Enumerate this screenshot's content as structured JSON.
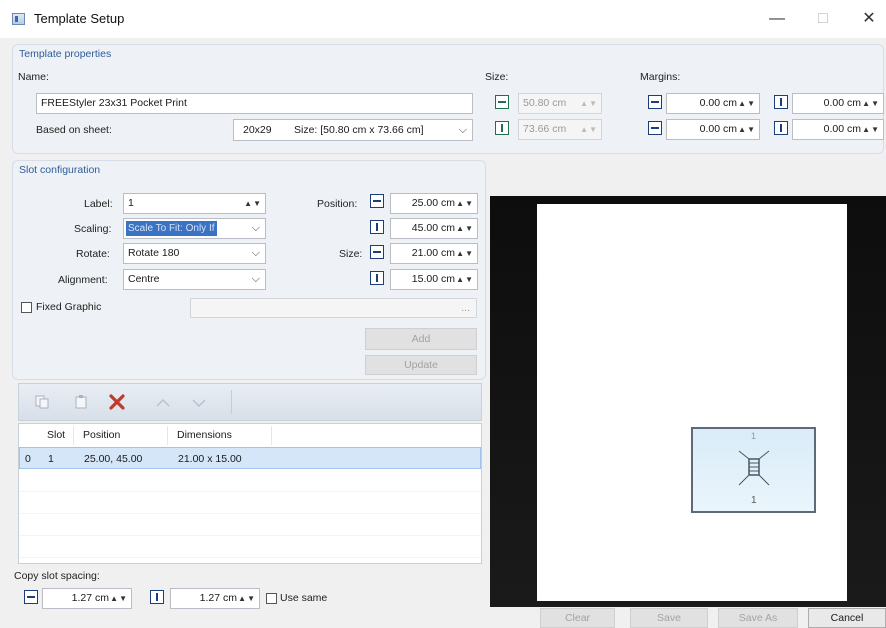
{
  "window": {
    "title": "Template Setup",
    "minimize": "—",
    "maximize": "□",
    "close": "✕"
  },
  "template_properties": {
    "title": "Template properties",
    "name_label": "Name:",
    "name_value": "FREEStyler 23x31 Pocket Print",
    "based_on_label": "Based on sheet:",
    "based_on_code": "20x29",
    "based_on_size": "Size: [50.80 cm x 73.66 cm]",
    "size_label": "Size:",
    "size_width": "50.80 cm",
    "size_height": "73.66 cm",
    "margins_label": "Margins:",
    "margin_left": "0.00 cm",
    "margin_top": "0.00 cm",
    "margin_right": "0.00 cm",
    "margin_bottom": "0.00 cm"
  },
  "slot_configuration": {
    "title": "Slot configuration",
    "label_label": "Label:",
    "label_value": "1",
    "scaling_label": "Scaling:",
    "scaling_value": "Scale To Fit: Only If",
    "rotate_label": "Rotate:",
    "rotate_value": "Rotate 180",
    "alignment_label": "Alignment:",
    "alignment_value": "Centre",
    "position_label": "Position:",
    "position_x": "25.00 cm",
    "position_y": "45.00 cm",
    "size_label": "Size:",
    "size_width": "21.00 cm",
    "size_height": "15.00 cm",
    "fixed_graphic_label": "Fixed Graphic",
    "fixed_graphic_ellipsis": "...",
    "add_label": "Add",
    "update_label": "Update"
  },
  "slot_list": {
    "headers": {
      "slot": "Slot",
      "position": "Position",
      "dimensions": "Dimensions"
    },
    "rows": [
      {
        "index": "0",
        "slot": "1",
        "position": "25.00, 45.00",
        "dimensions": "21.00 x 15.00"
      }
    ]
  },
  "spin_arrows": "▲▼",
  "dropdown_arrow": "⌵",
  "copy_spacing": {
    "label": "Copy slot spacing:",
    "horizontal": "1.27 cm",
    "vertical": "1.27 cm",
    "use_same_label": "Use same"
  },
  "preview": {
    "slot_top_label": "1",
    "slot_bottom_label": "1"
  },
  "buttons": {
    "clear": "Clear",
    "save": "Save",
    "save_as": "Save As",
    "cancel": "Cancel"
  },
  "icons": [
    "app-icon",
    "width-icon",
    "height-icon",
    "margin-left-icon",
    "margin-top-icon",
    "margin-right-icon",
    "margin-bottom-icon",
    "position-x-icon",
    "position-y-icon",
    "size-width-icon",
    "size-height-icon",
    "copy-icon",
    "paste-icon",
    "delete-icon",
    "move-up-icon",
    "move-down-icon",
    "spacing-horizontal-icon",
    "spacing-vertical-icon"
  ],
  "colors": {
    "accent": "#2e5d9a",
    "delete": "#c0392b",
    "selection": "#3a72c4",
    "preview_bg": "#111111"
  }
}
